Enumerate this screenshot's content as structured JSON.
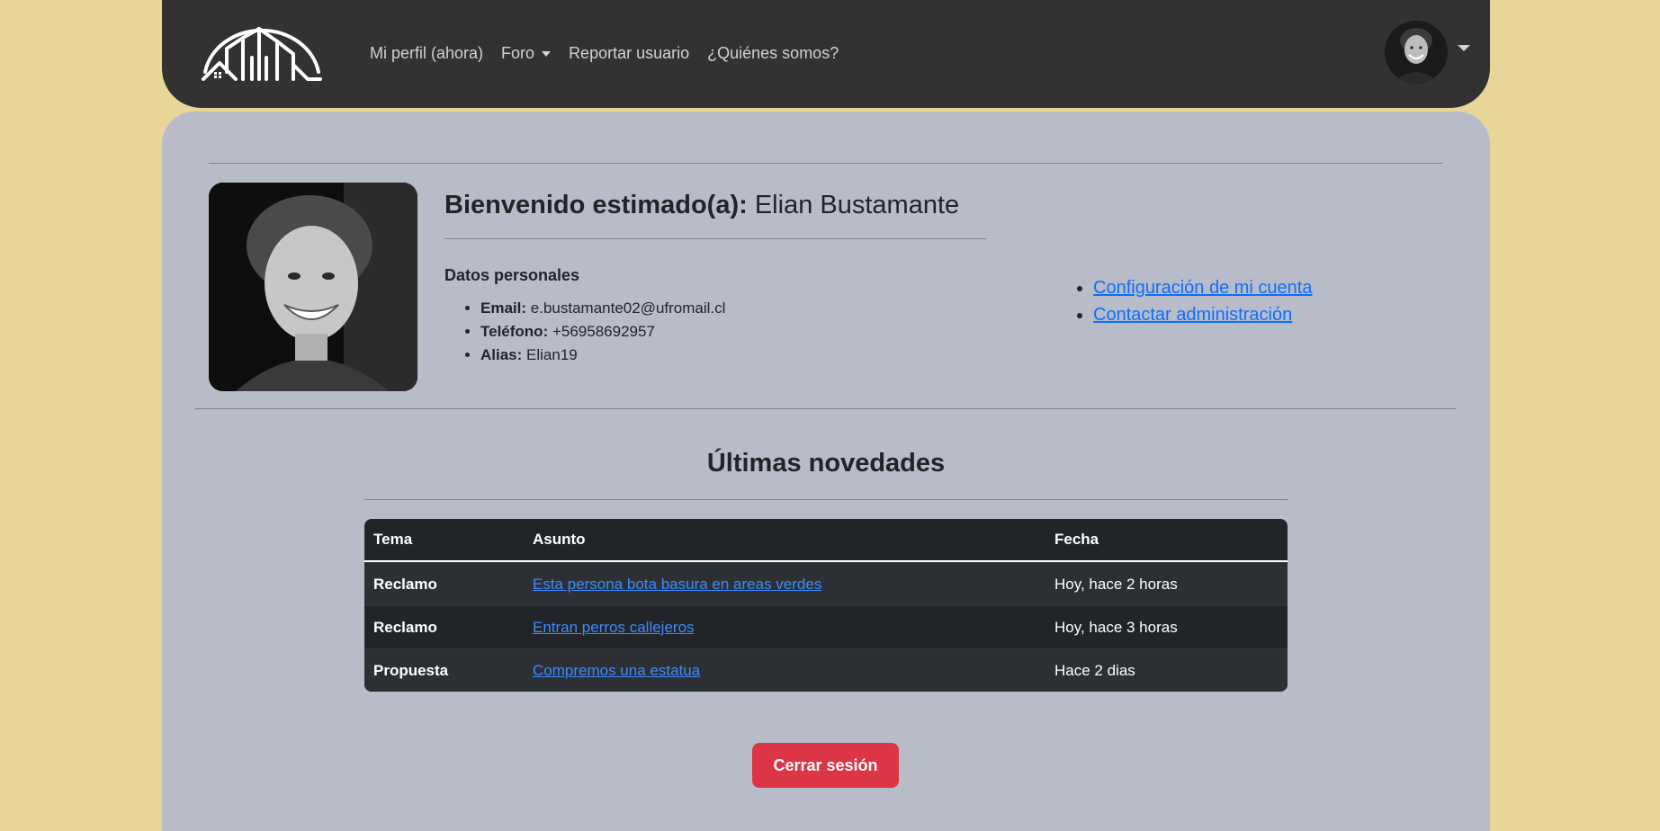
{
  "nav": {
    "links": [
      {
        "label": "Mi perfil (ahora)",
        "dropdown": false
      },
      {
        "label": "Foro",
        "dropdown": true
      },
      {
        "label": "Reportar usuario",
        "dropdown": false
      },
      {
        "label": "¿Quiénes somos?",
        "dropdown": false
      }
    ]
  },
  "profile": {
    "welcome_prefix": "Bienvenido estimado(a):",
    "name": "Elian Bustamante",
    "section_title": "Datos personales",
    "fields": [
      {
        "label": "Email:",
        "value": "e.bustamante02@ufromail.cl"
      },
      {
        "label": "Teléfono:",
        "value": "+56958692957"
      },
      {
        "label": "Alias:",
        "value": "Elian19"
      }
    ],
    "links": [
      "Configuración de mi cuenta",
      "Contactar administración"
    ]
  },
  "news": {
    "title": "Últimas novedades",
    "headers": [
      "Tema",
      "Asunto",
      "Fecha"
    ],
    "rows": [
      {
        "tema": "Reclamo",
        "asunto": "Esta persona bota basura en areas verdes",
        "fecha": "Hoy, hace 2 horas"
      },
      {
        "tema": "Reclamo",
        "asunto": "Entran perros callejeros",
        "fecha": "Hoy, hace 3 horas"
      },
      {
        "tema": "Propuesta",
        "asunto": "Compremos una estatua",
        "fecha": "Hace 2 dias"
      }
    ]
  },
  "logout_label": "Cerrar sesión",
  "colors": {
    "page_bg": "#e8d699",
    "navbar_bg": "#323232",
    "card_bg": "#b8bcc8",
    "link": "#0d6efd",
    "danger": "#dc3545",
    "table_bg": "#212529"
  }
}
